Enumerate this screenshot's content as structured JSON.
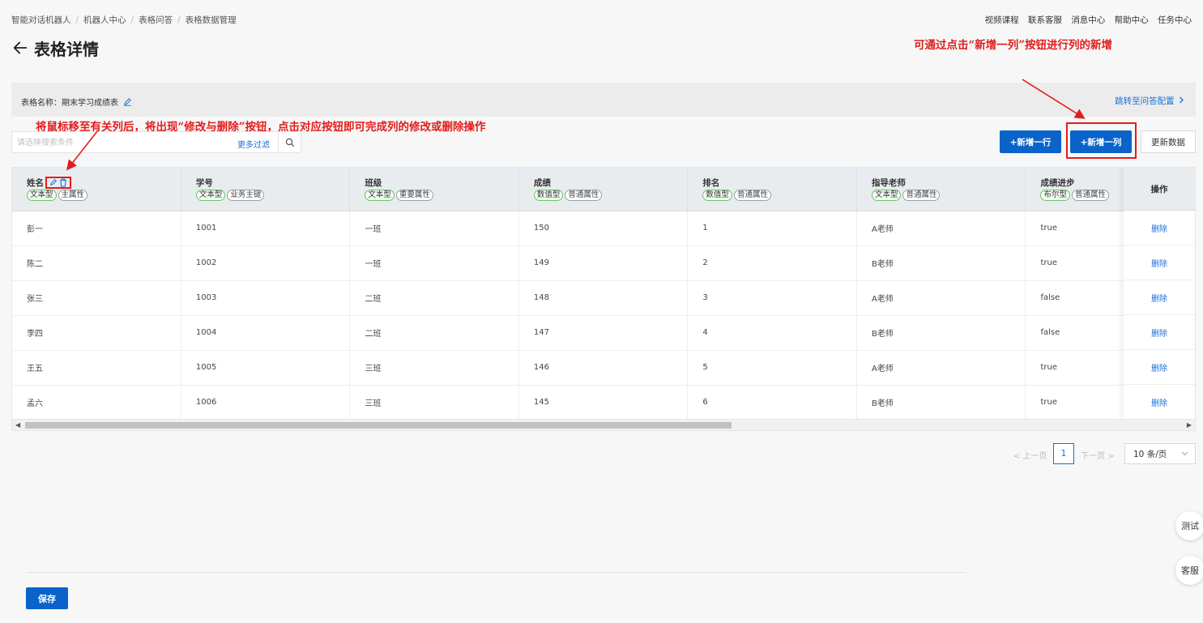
{
  "breadcrumb": [
    "智能对话机器人",
    "机器人中心",
    "表格问答",
    "表格数据管理"
  ],
  "top_links": [
    "视频课程",
    "联系客服",
    "消息中心",
    "帮助中心",
    "任务中心"
  ],
  "page_title": "表格详情",
  "table_info": {
    "name_label": "表格名称：期末学习成绩表",
    "jump_link": "跳转至问答配置"
  },
  "search": {
    "placeholder": "请选择搜索条件",
    "more_filter": "更多过滤"
  },
  "buttons": {
    "add_row": "+新增一行",
    "add_col": "+新增一列",
    "update": "更新数据",
    "save": "保存"
  },
  "annotations": {
    "top": "可通过点击“新增一列”按钮进行列的新增",
    "left": "将鼠标移至有关列后，将出现“修改与删除”按钮，点击对应按钮即可完成列的修改或删除操作"
  },
  "columns": [
    {
      "title": "姓名",
      "tags": [
        "文本型",
        "主属性"
      ]
    },
    {
      "title": "学号",
      "tags": [
        "文本型",
        "业务主键"
      ]
    },
    {
      "title": "班级",
      "tags": [
        "文本型",
        "重要属性"
      ]
    },
    {
      "title": "成绩",
      "tags": [
        "数值型",
        "普通属性"
      ]
    },
    {
      "title": "排名",
      "tags": [
        "数值型",
        "普通属性"
      ]
    },
    {
      "title": "指导老师",
      "tags": [
        "文本型",
        "普通属性"
      ]
    },
    {
      "title": "成绩进步",
      "tags": [
        "布尔型",
        "普通属性"
      ]
    }
  ],
  "op_header": "操作",
  "delete_label": "删除",
  "rows": [
    [
      "彭一",
      "1001",
      "一班",
      "150",
      "1",
      "A老师",
      "true"
    ],
    [
      "陈二",
      "1002",
      "一班",
      "149",
      "2",
      "B老师",
      "true"
    ],
    [
      "张三",
      "1003",
      "二班",
      "148",
      "3",
      "A老师",
      "false"
    ],
    [
      "李四",
      "1004",
      "二班",
      "147",
      "4",
      "B老师",
      "false"
    ],
    [
      "王五",
      "1005",
      "三班",
      "146",
      "5",
      "A老师",
      "true"
    ],
    [
      "孟六",
      "1006",
      "三班",
      "145",
      "6",
      "B老师",
      "true"
    ]
  ],
  "pagination": {
    "prev": "< 上一页",
    "current": "1",
    "next": "下一页 >",
    "page_size": "10 条/页"
  },
  "float_buttons": [
    "测试",
    "客服"
  ],
  "colors": {
    "primary": "#0a63c9",
    "link": "#1a6fd6",
    "annotation": "#e21c1c"
  }
}
